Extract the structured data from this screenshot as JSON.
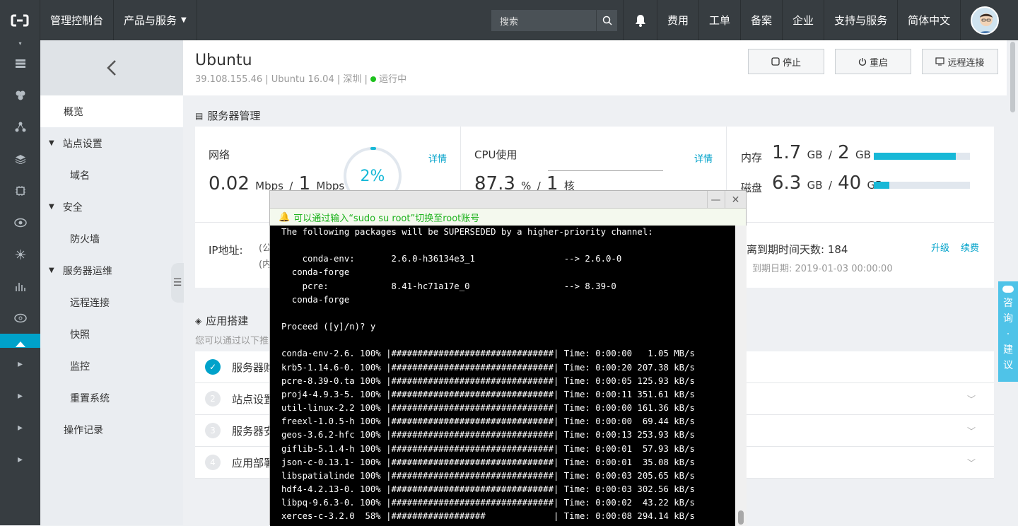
{
  "topbar": {
    "console": "管理控制台",
    "products": "产品与服务",
    "search_placeholder": "搜索",
    "nav": [
      "费用",
      "工单",
      "备案",
      "企业",
      "支持与服务",
      "简体中文"
    ]
  },
  "sidebar": {
    "items": [
      {
        "label": "概览",
        "kind": "item"
      },
      {
        "label": "站点设置",
        "kind": "group"
      },
      {
        "label": "域名",
        "kind": "sub"
      },
      {
        "label": "安全",
        "kind": "group"
      },
      {
        "label": "防火墙",
        "kind": "sub"
      },
      {
        "label": "服务器运维",
        "kind": "group"
      },
      {
        "label": "远程连接",
        "kind": "sub"
      },
      {
        "label": "快照",
        "kind": "sub"
      },
      {
        "label": "监控",
        "kind": "sub"
      },
      {
        "label": "重置系统",
        "kind": "sub"
      },
      {
        "label": "操作记录",
        "kind": "item"
      }
    ]
  },
  "header": {
    "title": "Ubuntu",
    "ip": "39.108.155.46",
    "os": "Ubuntu 16.04",
    "region": "深圳",
    "status": "运行中",
    "sep": "|",
    "buttons": {
      "stop": "停止",
      "restart": "重启",
      "remote": "远程连接"
    }
  },
  "server_mgmt": {
    "title": "服务器管理",
    "network": {
      "label": "网络",
      "value": "0.02",
      "unit": "Mbps",
      "slash": "/",
      "limit": "1",
      "limit_unit": "Mbps",
      "gauge": "2%",
      "details": "详情"
    },
    "cpu": {
      "label": "CPU使用",
      "value": "87.3",
      "unit": "%",
      "slash": "/",
      "cores": "1",
      "cores_unit": "核",
      "details": "详情"
    },
    "memory": {
      "label": "内存",
      "used": "1.7",
      "unit": "GB",
      "slash": "/",
      "total": "2",
      "total_unit": "GB",
      "fraction": 0.85
    },
    "disk": {
      "label": "磁盘",
      "used": "6.3",
      "unit": "GB",
      "slash": "/",
      "total": "40",
      "total_unit": "GB",
      "fraction": 0.16
    },
    "ip_label": "IP地址:",
    "ip_pub": "(公",
    "ip_priv": "(内",
    "expire_days_label": "离到期时间天数:",
    "expire_days": "184",
    "expire_date_label": "到期日期:",
    "expire_date": "2019-01-03 00:00:00",
    "upgrade": "升级",
    "renew": "续费"
  },
  "app_build": {
    "title": "应用搭建",
    "desc": "您可以通过以下推",
    "steps": [
      {
        "num": "✓",
        "label": "服务器购",
        "done": true
      },
      {
        "num": "2",
        "label": "站点设置",
        "done": false
      },
      {
        "num": "3",
        "label": "服务器安",
        "done": false
      },
      {
        "num": "4",
        "label": "应用部署",
        "done": false
      }
    ]
  },
  "consult": [
    "咨",
    "询",
    "·",
    "建",
    "议"
  ],
  "terminal": {
    "tip": "可以通过输入“sudo su root”切换至root账号",
    "lines": [
      "The following packages will be SUPERSEDED by a higher-priority channel:",
      "",
      "    conda-env:       2.6.0-h36134e3_1                 --> 2.6.0-0",
      "  conda-forge",
      "    pcre:            8.41-hc71a17e_0                  --> 8.39-0",
      "  conda-forge",
      "",
      "Proceed ([y]/n)? y",
      "",
      "conda-env-2.6. 100% |###############################| Time: 0:00:00   1.05 MB/s",
      "krb5-1.14.6-0. 100% |###############################| Time: 0:00:20 207.38 kB/s",
      "pcre-8.39-0.ta 100% |###############################| Time: 0:00:05 125.93 kB/s",
      "proj4-4.9.3-5. 100% |###############################| Time: 0:00:11 351.61 kB/s",
      "util-linux-2.2 100% |###############################| Time: 0:00:00 161.36 kB/s",
      "freexl-1.0.5-h 100% |###############################| Time: 0:00:00  69.44 kB/s",
      "geos-3.6.2-hfc 100% |###############################| Time: 0:00:13 253.93 kB/s",
      "giflib-5.1.4-h 100% |###############################| Time: 0:00:01  57.93 kB/s",
      "json-c-0.13.1- 100% |###############################| Time: 0:00:01  35.08 kB/s",
      "libspatialinde 100% |###############################| Time: 0:00:03 205.65 kB/s",
      "hdf4-4.2.13-0. 100% |###############################| Time: 0:00:03 302.56 kB/s",
      "libpq-9.6.3-0. 100% |###############################| Time: 0:00:02  43.22 kB/s",
      "xerces-c-3.2.0  58% |##################             | Time: 0:00:08 294.14 kB/s"
    ]
  }
}
